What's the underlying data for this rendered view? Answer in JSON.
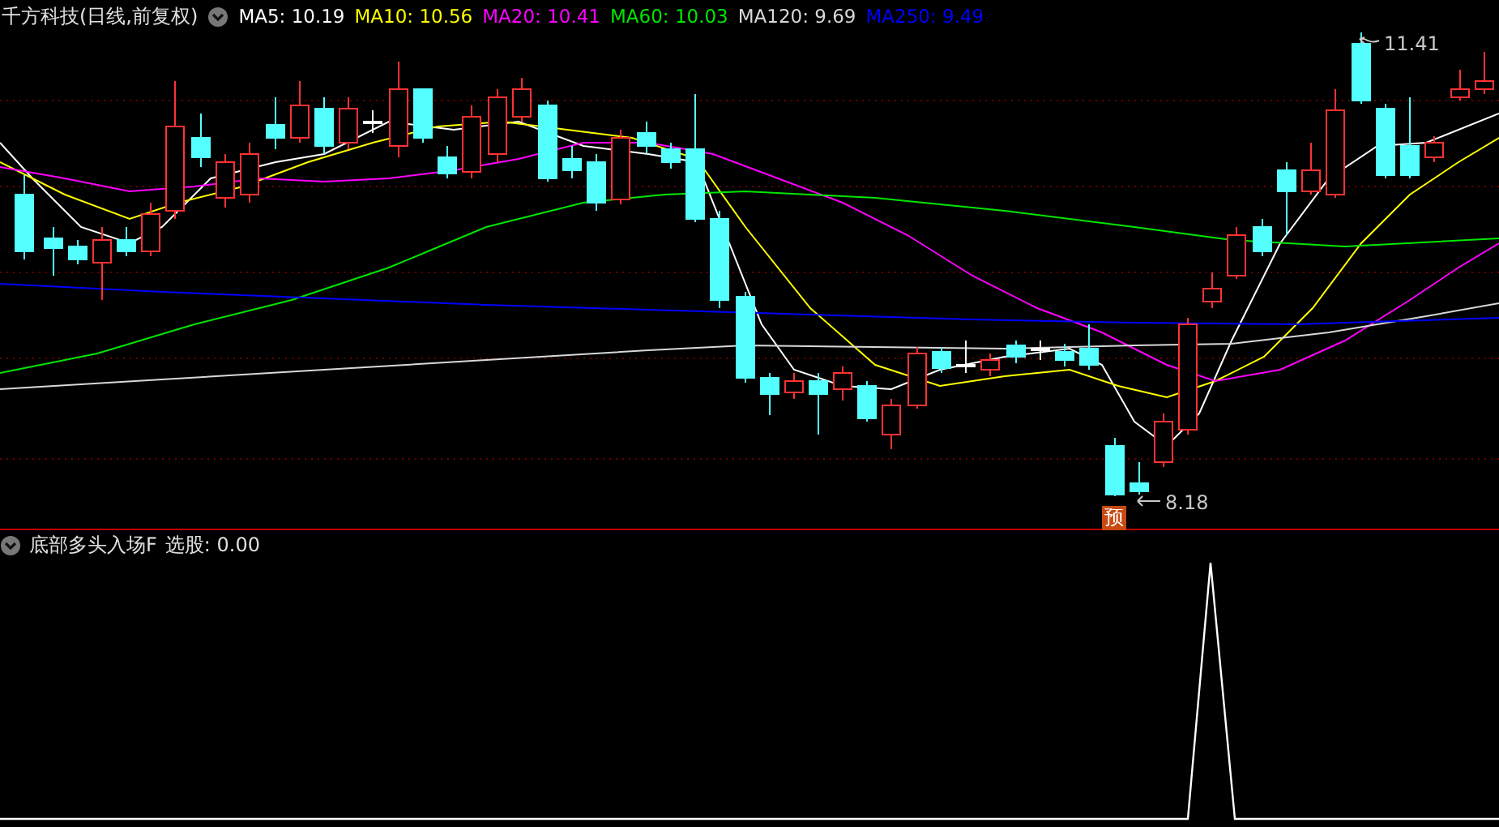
{
  "chart_header": {
    "title": "千方科技(日线,前复权)",
    "moving_averages": [
      {
        "text": "MA5: 10.19",
        "color": "#ffffff"
      },
      {
        "text": "MA10: 10.56",
        "color": "#ffff00"
      },
      {
        "text": "MA20: 10.41",
        "color": "#ff00ff"
      },
      {
        "text": "MA60: 10.03",
        "color": "#00e600"
      },
      {
        "text": "MA120: 9.69",
        "color": "#d8d8d8"
      },
      {
        "text": "MA250: 9.49",
        "color": "#0000ff"
      }
    ]
  },
  "price_chart": {
    "high_label": "11.41",
    "low_label": "8.18",
    "forecast_badge": "预"
  },
  "indicator_panel": {
    "name": "底部多头入场F",
    "reading": "选股: 0.00"
  }
}
